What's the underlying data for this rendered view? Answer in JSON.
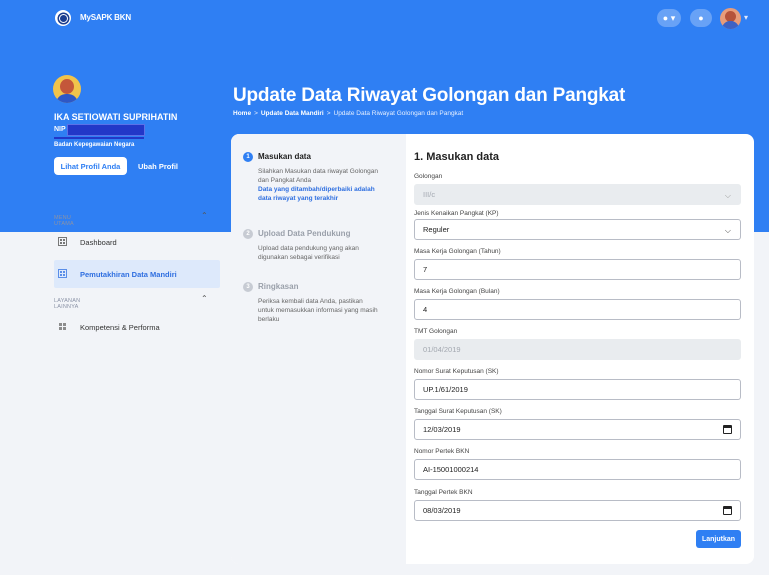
{
  "app": {
    "title": "MySAPK BKN"
  },
  "profile": {
    "name": "IKA SETIOWATI SUPRIHATIN",
    "nip_label": "NIP",
    "agency": "Badan Kepegawaian Negara",
    "view_profile_label": "Lihat Profil Anda",
    "edit_profile_label": "Ubah Profil"
  },
  "page": {
    "title": "Update Data Riwayat Golongan dan Pangkat",
    "breadcrumb": [
      "Home",
      "Update Data Mandiri",
      "Update Data Riwayat Golongan dan Pangkat"
    ]
  },
  "sidebar": {
    "section_main": "MENU UTAMA",
    "main_items": [
      {
        "label": "Dashboard"
      },
      {
        "label": "Pemutakhiran Data Mandiri",
        "active": true
      }
    ],
    "section_other": "LAYANAN LAINNYA",
    "other_items": [
      {
        "label": "Kompetensi & Performa"
      }
    ]
  },
  "steps": [
    {
      "number": "1",
      "title": "Masukan data",
      "description": "Silahkan Masukan data riwayat Golongan dan Pangkat Anda",
      "note": "Data yang ditambah/diperbaiki adalah data riwayat yang terakhir",
      "active": true
    },
    {
      "number": "2",
      "title": "Upload Data Pendukung",
      "description": "Upload data pendukung yang akan digunakan sebagai verifikasi",
      "active": false
    },
    {
      "number": "3",
      "title": "Ringkasan",
      "description": "Periksa kembali data Anda, pastikan untuk memasukkan informasi yang masih berlaku",
      "active": false
    }
  ],
  "form": {
    "title": "1. Masukan data",
    "fields": {
      "golongan": {
        "label": "Golongan",
        "value": "III/c"
      },
      "jenis_kp": {
        "label": "Jenis Kenaikan Pangkat (KP)",
        "value": "Reguler"
      },
      "mk_tahun": {
        "label": "Masa Kerja Golongan (Tahun)",
        "value": "7"
      },
      "mk_bulan": {
        "label": "Masa Kerja Golongan (Bulan)",
        "value": "4"
      },
      "tmt": {
        "label": "TMT Golongan",
        "value": "01/04/2019"
      },
      "no_sk": {
        "label": "Nomor Surat Keputusan (SK)",
        "value": "UP.1/61/2019"
      },
      "tgl_sk": {
        "label": "Tanggal Surat Keputusan (SK)",
        "value": "12/03/2019"
      },
      "no_pertek": {
        "label": "Nomor Pertek BKN",
        "value": "AI-15001000214"
      },
      "tgl_pertek": {
        "label": "Tanggal Pertek BKN",
        "value": "08/03/2019"
      }
    },
    "submit_label": "Lanjutkan"
  },
  "icons": {
    "help": "question-icon",
    "notification": "bell-icon",
    "calendar": "calendar-icon",
    "chevron": "chevron-down-icon"
  },
  "colors": {
    "primary": "#2f7ff3",
    "background": "#f2f4f8"
  }
}
